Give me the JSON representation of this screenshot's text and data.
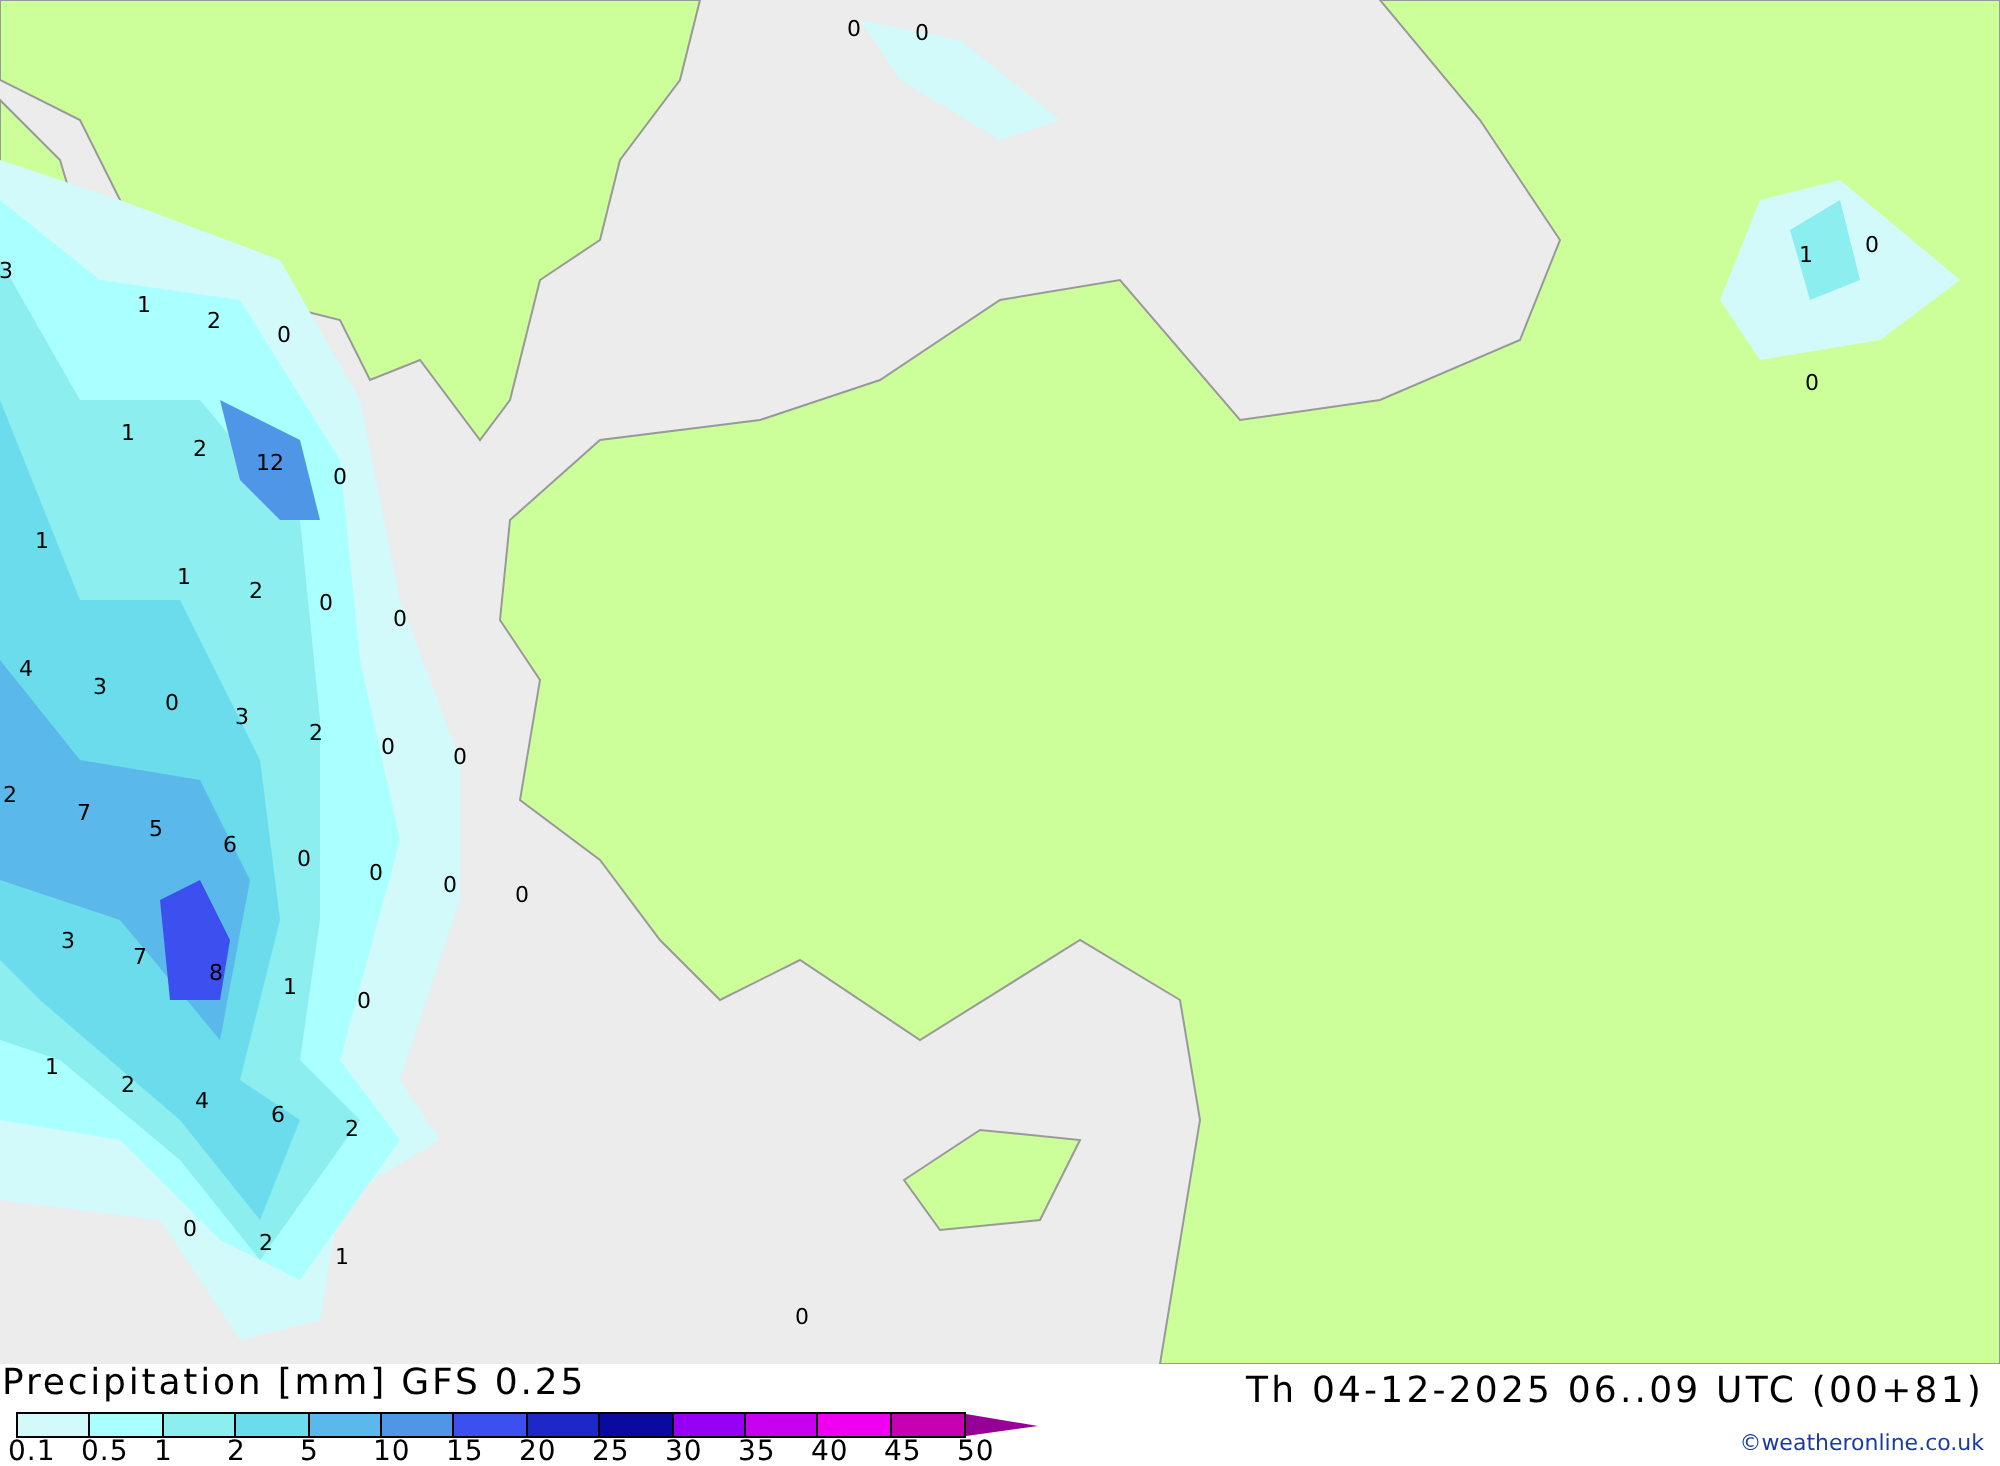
{
  "map": {
    "values": [
      {
        "text": "0"
      },
      {
        "text": "0"
      },
      {
        "text": "3"
      },
      {
        "text": "1"
      },
      {
        "text": "2"
      },
      {
        "text": "0"
      },
      {
        "text": "1"
      },
      {
        "text": "0"
      },
      {
        "text": "0"
      },
      {
        "text": "1"
      },
      {
        "text": "2"
      },
      {
        "text": "12"
      },
      {
        "text": "0"
      },
      {
        "text": "1"
      },
      {
        "text": "1"
      },
      {
        "text": "2"
      },
      {
        "text": "0"
      },
      {
        "text": "0"
      },
      {
        "text": "4"
      },
      {
        "text": "3"
      },
      {
        "text": "0"
      },
      {
        "text": "3"
      },
      {
        "text": "2"
      },
      {
        "text": "0"
      },
      {
        "text": "0"
      },
      {
        "text": "2"
      },
      {
        "text": "7"
      },
      {
        "text": "5"
      },
      {
        "text": "6"
      },
      {
        "text": "0"
      },
      {
        "text": "0"
      },
      {
        "text": "0"
      },
      {
        "text": "0"
      },
      {
        "text": "3"
      },
      {
        "text": "7"
      },
      {
        "text": "8"
      },
      {
        "text": "1"
      },
      {
        "text": "0"
      },
      {
        "text": "1"
      },
      {
        "text": "2"
      },
      {
        "text": "4"
      },
      {
        "text": "6"
      },
      {
        "text": "2"
      },
      {
        "text": "0"
      },
      {
        "text": "2"
      },
      {
        "text": "1"
      },
      {
        "text": "0"
      }
    ]
  },
  "legend": {
    "title": "Precipitation [mm] GFS 0.25",
    "swatches": [
      {
        "color": "#d2fafa"
      },
      {
        "color": "#aaffff"
      },
      {
        "color": "#8ceeee"
      },
      {
        "color": "#6adcec"
      },
      {
        "color": "#5ab9ea"
      },
      {
        "color": "#5096e6"
      },
      {
        "color": "#3c50f0"
      },
      {
        "color": "#1e28c8"
      },
      {
        "color": "#0a0aa0"
      },
      {
        "color": "#9600f5"
      },
      {
        "color": "#c800f0"
      },
      {
        "color": "#f000f0"
      },
      {
        "color": "#c800b4"
      }
    ],
    "ticks": [
      "0.1",
      "0.5",
      "1",
      "2",
      "5",
      "10",
      "15",
      "20",
      "25",
      "30",
      "35",
      "40",
      "45",
      "50"
    ]
  },
  "run_info": "Th 04-12-2025 06..09 UTC (00+81)",
  "credit": "©weatheronline.co.uk"
}
